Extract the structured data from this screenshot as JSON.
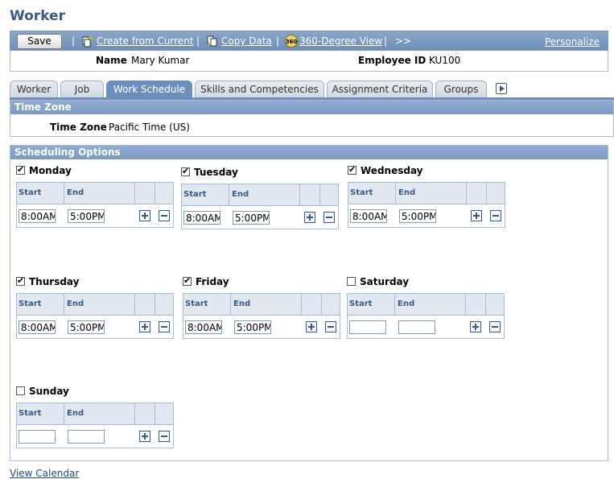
{
  "page": {
    "title": "Worker"
  },
  "toolbar": {
    "save_label": "Save",
    "create_from_current": "Create from Current",
    "copy_data": "Copy Data",
    "view_360": "360-Degree View",
    "more": ">>",
    "personalize": "Personalize",
    "sep": "|"
  },
  "identity": {
    "name_label": "Name",
    "name_value": "Mary Kumar",
    "emp_label": "Employee ID",
    "emp_value": "KU100"
  },
  "tabs": [
    {
      "label": "Worker"
    },
    {
      "label": "Job"
    },
    {
      "label": "Work Schedule"
    },
    {
      "label": "Skills and Competencies"
    },
    {
      "label": "Assignment Criteria"
    },
    {
      "label": "Groups"
    }
  ],
  "timezone": {
    "section_title": "Time Zone",
    "label": "Time Zone",
    "value": "Pacific Time (US)"
  },
  "scheduling": {
    "section_title": "Scheduling Options",
    "start_header": "Start",
    "end_header": "End",
    "days": [
      {
        "name": "Monday",
        "checked": true,
        "start": "8:00AM",
        "end": "5:00PM"
      },
      {
        "name": "Tuesday",
        "checked": true,
        "start": "8:00AM",
        "end": "5:00PM"
      },
      {
        "name": "Wednesday",
        "checked": true,
        "start": "8:00AM",
        "end": "5:00PM"
      },
      {
        "name": "Thursday",
        "checked": true,
        "start": "8:00AM",
        "end": "5:00PM"
      },
      {
        "name": "Friday",
        "checked": true,
        "start": "8:00AM",
        "end": "5:00PM"
      },
      {
        "name": "Saturday",
        "checked": false,
        "start": "",
        "end": ""
      },
      {
        "name": "Sunday",
        "checked": false,
        "start": "",
        "end": ""
      }
    ]
  },
  "footer": {
    "view_calendar": "View Calendar"
  }
}
